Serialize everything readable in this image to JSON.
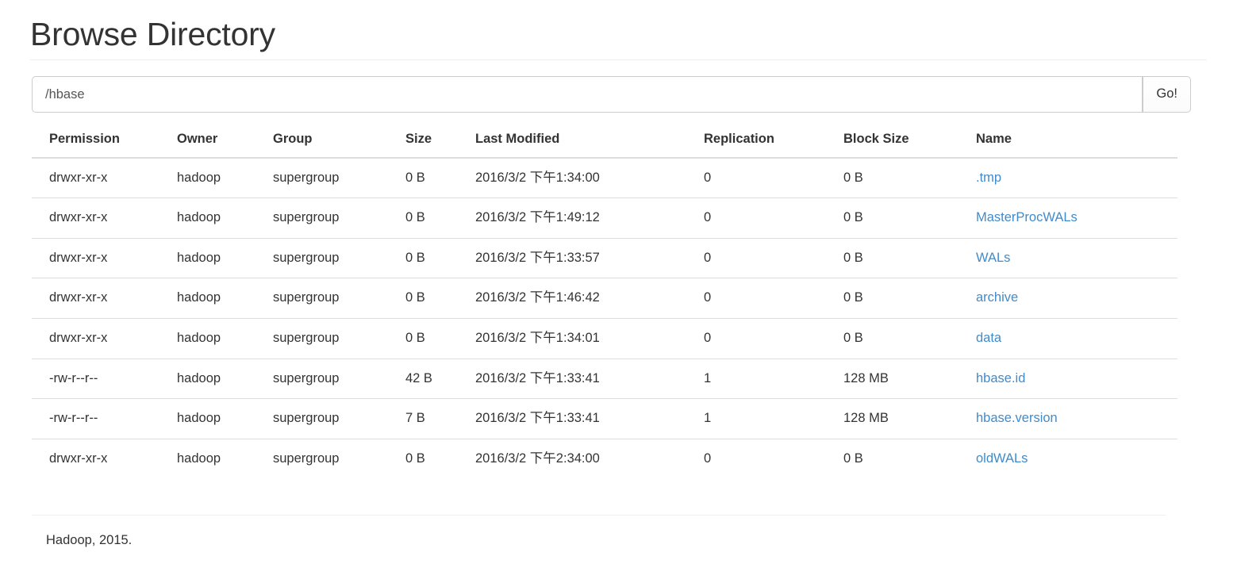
{
  "page": {
    "title": "Browse Directory"
  },
  "path_form": {
    "value": "/hbase",
    "placeholder": "/hbase",
    "go_label": "Go!"
  },
  "table": {
    "columns": [
      "Permission",
      "Owner",
      "Group",
      "Size",
      "Last Modified",
      "Replication",
      "Block Size",
      "Name"
    ],
    "rows": [
      {
        "permission": "drwxr-xr-x",
        "owner": "hadoop",
        "group": "supergroup",
        "size": "0 B",
        "last_modified": "2016/3/2 下午1:34:00",
        "replication": "0",
        "block_size": "0 B",
        "name": ".tmp"
      },
      {
        "permission": "drwxr-xr-x",
        "owner": "hadoop",
        "group": "supergroup",
        "size": "0 B",
        "last_modified": "2016/3/2 下午1:49:12",
        "replication": "0",
        "block_size": "0 B",
        "name": "MasterProcWALs"
      },
      {
        "permission": "drwxr-xr-x",
        "owner": "hadoop",
        "group": "supergroup",
        "size": "0 B",
        "last_modified": "2016/3/2 下午1:33:57",
        "replication": "0",
        "block_size": "0 B",
        "name": "WALs"
      },
      {
        "permission": "drwxr-xr-x",
        "owner": "hadoop",
        "group": "supergroup",
        "size": "0 B",
        "last_modified": "2016/3/2 下午1:46:42",
        "replication": "0",
        "block_size": "0 B",
        "name": "archive"
      },
      {
        "permission": "drwxr-xr-x",
        "owner": "hadoop",
        "group": "supergroup",
        "size": "0 B",
        "last_modified": "2016/3/2 下午1:34:01",
        "replication": "0",
        "block_size": "0 B",
        "name": "data"
      },
      {
        "permission": "-rw-r--r--",
        "owner": "hadoop",
        "group": "supergroup",
        "size": "42 B",
        "last_modified": "2016/3/2 下午1:33:41",
        "replication": "1",
        "block_size": "128 MB",
        "name": "hbase.id"
      },
      {
        "permission": "-rw-r--r--",
        "owner": "hadoop",
        "group": "supergroup",
        "size": "7 B",
        "last_modified": "2016/3/2 下午1:33:41",
        "replication": "1",
        "block_size": "128 MB",
        "name": "hbase.version"
      },
      {
        "permission": "drwxr-xr-x",
        "owner": "hadoop",
        "group": "supergroup",
        "size": "0 B",
        "last_modified": "2016/3/2 下午2:34:00",
        "replication": "0",
        "block_size": "0 B",
        "name": "oldWALs"
      }
    ]
  },
  "footer": {
    "text": "Hadoop, 2015."
  },
  "colors": {
    "link": "#428bca",
    "text": "#333333",
    "border": "#dddddd",
    "rule": "#eeeeee"
  }
}
